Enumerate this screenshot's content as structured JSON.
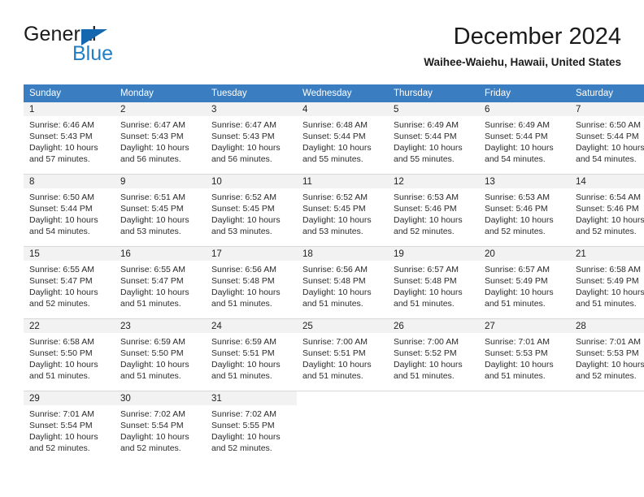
{
  "brand": {
    "name_part1": "General",
    "name_part2": "Blue",
    "logo_icon": "triangle-logo-icon",
    "accent_color": "#1f7ec4"
  },
  "header": {
    "title": "December 2024",
    "subtitle": "Waihee-Waiehu, Hawaii, United States"
  },
  "theme": {
    "header_blue": "#3a7dc0",
    "daynum_band": "#f2f2f2",
    "text": "#2b2b2b"
  },
  "weekday_headers": [
    "Sunday",
    "Monday",
    "Tuesday",
    "Wednesday",
    "Thursday",
    "Friday",
    "Saturday"
  ],
  "weeks": [
    [
      {
        "day": "1",
        "sunrise": "Sunrise: 6:46 AM",
        "sunset": "Sunset: 5:43 PM",
        "daylight_line1": "Daylight: 10 hours",
        "daylight_line2": "and 57 minutes."
      },
      {
        "day": "2",
        "sunrise": "Sunrise: 6:47 AM",
        "sunset": "Sunset: 5:43 PM",
        "daylight_line1": "Daylight: 10 hours",
        "daylight_line2": "and 56 minutes."
      },
      {
        "day": "3",
        "sunrise": "Sunrise: 6:47 AM",
        "sunset": "Sunset: 5:43 PM",
        "daylight_line1": "Daylight: 10 hours",
        "daylight_line2": "and 56 minutes."
      },
      {
        "day": "4",
        "sunrise": "Sunrise: 6:48 AM",
        "sunset": "Sunset: 5:44 PM",
        "daylight_line1": "Daylight: 10 hours",
        "daylight_line2": "and 55 minutes."
      },
      {
        "day": "5",
        "sunrise": "Sunrise: 6:49 AM",
        "sunset": "Sunset: 5:44 PM",
        "daylight_line1": "Daylight: 10 hours",
        "daylight_line2": "and 55 minutes."
      },
      {
        "day": "6",
        "sunrise": "Sunrise: 6:49 AM",
        "sunset": "Sunset: 5:44 PM",
        "daylight_line1": "Daylight: 10 hours",
        "daylight_line2": "and 54 minutes."
      },
      {
        "day": "7",
        "sunrise": "Sunrise: 6:50 AM",
        "sunset": "Sunset: 5:44 PM",
        "daylight_line1": "Daylight: 10 hours",
        "daylight_line2": "and 54 minutes."
      }
    ],
    [
      {
        "day": "8",
        "sunrise": "Sunrise: 6:50 AM",
        "sunset": "Sunset: 5:44 PM",
        "daylight_line1": "Daylight: 10 hours",
        "daylight_line2": "and 54 minutes."
      },
      {
        "day": "9",
        "sunrise": "Sunrise: 6:51 AM",
        "sunset": "Sunset: 5:45 PM",
        "daylight_line1": "Daylight: 10 hours",
        "daylight_line2": "and 53 minutes."
      },
      {
        "day": "10",
        "sunrise": "Sunrise: 6:52 AM",
        "sunset": "Sunset: 5:45 PM",
        "daylight_line1": "Daylight: 10 hours",
        "daylight_line2": "and 53 minutes."
      },
      {
        "day": "11",
        "sunrise": "Sunrise: 6:52 AM",
        "sunset": "Sunset: 5:45 PM",
        "daylight_line1": "Daylight: 10 hours",
        "daylight_line2": "and 53 minutes."
      },
      {
        "day": "12",
        "sunrise": "Sunrise: 6:53 AM",
        "sunset": "Sunset: 5:46 PM",
        "daylight_line1": "Daylight: 10 hours",
        "daylight_line2": "and 52 minutes."
      },
      {
        "day": "13",
        "sunrise": "Sunrise: 6:53 AM",
        "sunset": "Sunset: 5:46 PM",
        "daylight_line1": "Daylight: 10 hours",
        "daylight_line2": "and 52 minutes."
      },
      {
        "day": "14",
        "sunrise": "Sunrise: 6:54 AM",
        "sunset": "Sunset: 5:46 PM",
        "daylight_line1": "Daylight: 10 hours",
        "daylight_line2": "and 52 minutes."
      }
    ],
    [
      {
        "day": "15",
        "sunrise": "Sunrise: 6:55 AM",
        "sunset": "Sunset: 5:47 PM",
        "daylight_line1": "Daylight: 10 hours",
        "daylight_line2": "and 52 minutes."
      },
      {
        "day": "16",
        "sunrise": "Sunrise: 6:55 AM",
        "sunset": "Sunset: 5:47 PM",
        "daylight_line1": "Daylight: 10 hours",
        "daylight_line2": "and 51 minutes."
      },
      {
        "day": "17",
        "sunrise": "Sunrise: 6:56 AM",
        "sunset": "Sunset: 5:48 PM",
        "daylight_line1": "Daylight: 10 hours",
        "daylight_line2": "and 51 minutes."
      },
      {
        "day": "18",
        "sunrise": "Sunrise: 6:56 AM",
        "sunset": "Sunset: 5:48 PM",
        "daylight_line1": "Daylight: 10 hours",
        "daylight_line2": "and 51 minutes."
      },
      {
        "day": "19",
        "sunrise": "Sunrise: 6:57 AM",
        "sunset": "Sunset: 5:48 PM",
        "daylight_line1": "Daylight: 10 hours",
        "daylight_line2": "and 51 minutes."
      },
      {
        "day": "20",
        "sunrise": "Sunrise: 6:57 AM",
        "sunset": "Sunset: 5:49 PM",
        "daylight_line1": "Daylight: 10 hours",
        "daylight_line2": "and 51 minutes."
      },
      {
        "day": "21",
        "sunrise": "Sunrise: 6:58 AM",
        "sunset": "Sunset: 5:49 PM",
        "daylight_line1": "Daylight: 10 hours",
        "daylight_line2": "and 51 minutes."
      }
    ],
    [
      {
        "day": "22",
        "sunrise": "Sunrise: 6:58 AM",
        "sunset": "Sunset: 5:50 PM",
        "daylight_line1": "Daylight: 10 hours",
        "daylight_line2": "and 51 minutes."
      },
      {
        "day": "23",
        "sunrise": "Sunrise: 6:59 AM",
        "sunset": "Sunset: 5:50 PM",
        "daylight_line1": "Daylight: 10 hours",
        "daylight_line2": "and 51 minutes."
      },
      {
        "day": "24",
        "sunrise": "Sunrise: 6:59 AM",
        "sunset": "Sunset: 5:51 PM",
        "daylight_line1": "Daylight: 10 hours",
        "daylight_line2": "and 51 minutes."
      },
      {
        "day": "25",
        "sunrise": "Sunrise: 7:00 AM",
        "sunset": "Sunset: 5:51 PM",
        "daylight_line1": "Daylight: 10 hours",
        "daylight_line2": "and 51 minutes."
      },
      {
        "day": "26",
        "sunrise": "Sunrise: 7:00 AM",
        "sunset": "Sunset: 5:52 PM",
        "daylight_line1": "Daylight: 10 hours",
        "daylight_line2": "and 51 minutes."
      },
      {
        "day": "27",
        "sunrise": "Sunrise: 7:01 AM",
        "sunset": "Sunset: 5:53 PM",
        "daylight_line1": "Daylight: 10 hours",
        "daylight_line2": "and 51 minutes."
      },
      {
        "day": "28",
        "sunrise": "Sunrise: 7:01 AM",
        "sunset": "Sunset: 5:53 PM",
        "daylight_line1": "Daylight: 10 hours",
        "daylight_line2": "and 52 minutes."
      }
    ],
    [
      {
        "day": "29",
        "sunrise": "Sunrise: 7:01 AM",
        "sunset": "Sunset: 5:54 PM",
        "daylight_line1": "Daylight: 10 hours",
        "daylight_line2": "and 52 minutes."
      },
      {
        "day": "30",
        "sunrise": "Sunrise: 7:02 AM",
        "sunset": "Sunset: 5:54 PM",
        "daylight_line1": "Daylight: 10 hours",
        "daylight_line2": "and 52 minutes."
      },
      {
        "day": "31",
        "sunrise": "Sunrise: 7:02 AM",
        "sunset": "Sunset: 5:55 PM",
        "daylight_line1": "Daylight: 10 hours",
        "daylight_line2": "and 52 minutes."
      },
      {
        "day": "",
        "sunrise": "",
        "sunset": "",
        "daylight_line1": "",
        "daylight_line2": ""
      },
      {
        "day": "",
        "sunrise": "",
        "sunset": "",
        "daylight_line1": "",
        "daylight_line2": ""
      },
      {
        "day": "",
        "sunrise": "",
        "sunset": "",
        "daylight_line1": "",
        "daylight_line2": ""
      },
      {
        "day": "",
        "sunrise": "",
        "sunset": "",
        "daylight_line1": "",
        "daylight_line2": ""
      }
    ]
  ]
}
